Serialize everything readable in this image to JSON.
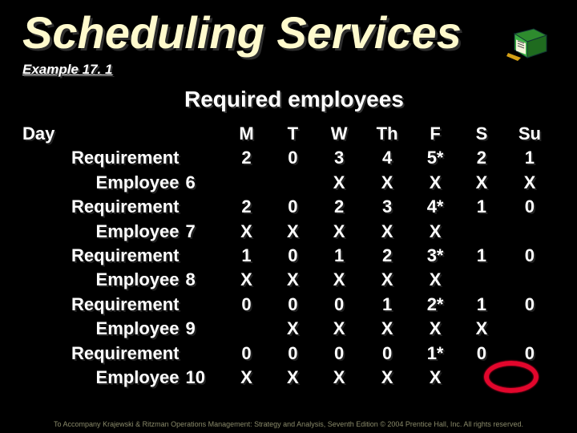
{
  "title": "Scheduling Services",
  "example_label": "Example 17. 1",
  "subhead": "Required employees",
  "day_label": "Day",
  "columns": [
    "M",
    "T",
    "W",
    "Th",
    "F",
    "S",
    "Su"
  ],
  "row_labels": {
    "requirement": "Requirement",
    "employee": "Employee"
  },
  "employees": [
    "6",
    "7",
    "8",
    "9",
    "10"
  ],
  "rows": [
    {
      "type": "req",
      "cells": [
        "2",
        "0",
        "3",
        "4",
        "5*",
        "2",
        "1"
      ]
    },
    {
      "type": "emp",
      "n": "6",
      "cells": [
        "",
        "",
        "X",
        "X",
        "X",
        "X",
        "X"
      ]
    },
    {
      "type": "req",
      "cells": [
        "2",
        "0",
        "2",
        "3",
        "4*",
        "1",
        "0"
      ]
    },
    {
      "type": "emp",
      "n": "7",
      "cells": [
        "X",
        "X",
        "X",
        "X",
        "X",
        "",
        ""
      ]
    },
    {
      "type": "req",
      "cells": [
        "1",
        "0",
        "1",
        "2",
        "3*",
        "1",
        "0"
      ]
    },
    {
      "type": "emp",
      "n": "8",
      "cells": [
        "X",
        "X",
        "X",
        "X",
        "X",
        "",
        ""
      ]
    },
    {
      "type": "req",
      "cells": [
        "0",
        "0",
        "0",
        "1",
        "2*",
        "1",
        "0"
      ]
    },
    {
      "type": "emp",
      "n": "9",
      "cells": [
        "",
        "X",
        "X",
        "X",
        "X",
        "X",
        ""
      ]
    },
    {
      "type": "req",
      "cells": [
        "0",
        "0",
        "0",
        "0",
        "1*",
        "0",
        "0"
      ]
    },
    {
      "type": "emp",
      "n": "10",
      "cells": [
        "X",
        "X",
        "X",
        "X",
        "X",
        "",
        ""
      ]
    }
  ],
  "footer": "To Accompany Krajewski & Ritzman Operations Management: Strategy and Analysis, Seventh Edition © 2004 Prentice Hall, Inc. All rights reserved.",
  "icon_name": "schedule-cube-icon",
  "colors": {
    "title": "#fffacd",
    "accent_red": "#e2062c",
    "bg": "#000000",
    "text": "#ffffff"
  }
}
